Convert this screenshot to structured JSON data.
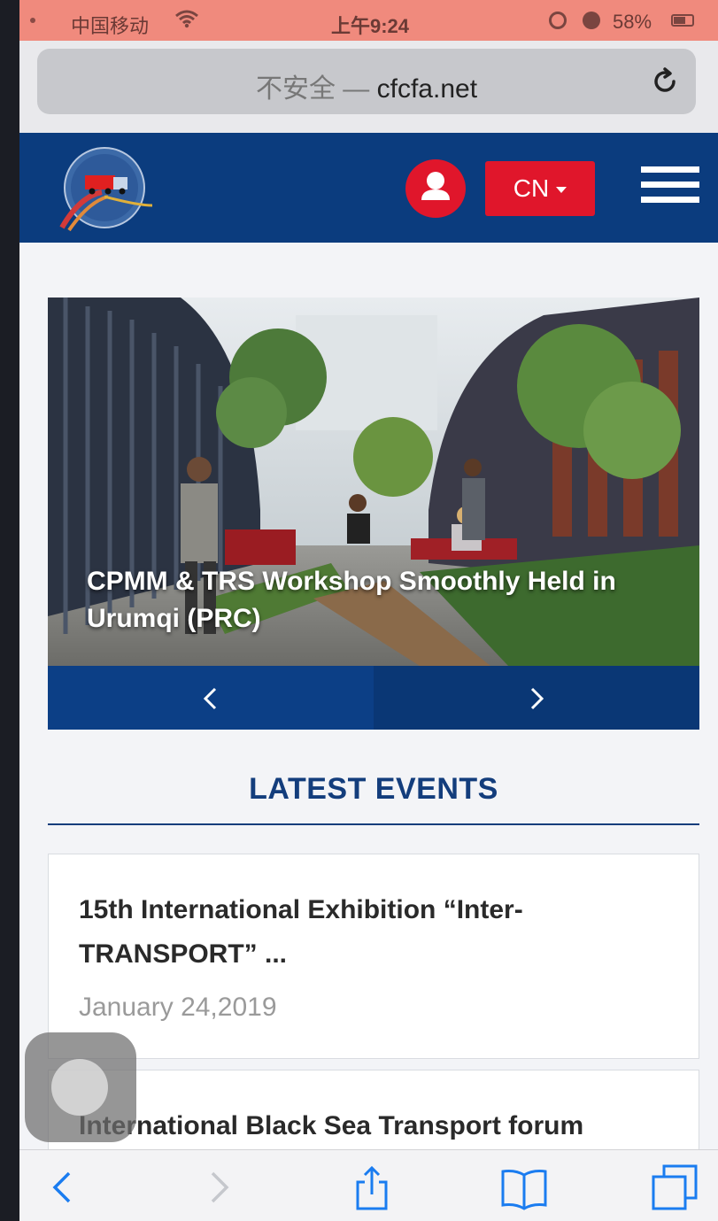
{
  "status_bar": {
    "carrier": "中国移动",
    "time": "上午9:24",
    "battery": "58%"
  },
  "browser": {
    "security_label": "不安全 —",
    "domain": "cfcfa.net"
  },
  "header": {
    "language": "CN",
    "brand_color": "#0b3c7e",
    "accent_color": "#e0162b"
  },
  "slider": {
    "caption": "CPMM & TRS Workshop Smoothly Held in Urumqi (PRC)"
  },
  "events": {
    "heading": "LATEST EVENTS",
    "items": [
      {
        "title": "15th International Exhibition “Inter-TRANSPORT” ...",
        "date": "January 24,2019"
      },
      {
        "title": "International Black Sea Transport forum"
      }
    ]
  },
  "icons": {
    "status": [
      "wifi-icon",
      "rotation-lock-icon",
      "alarm-icon",
      "battery-icon"
    ],
    "header": [
      "user-icon",
      "caret-down-icon",
      "hamburger-menu-icon"
    ],
    "toolbar": [
      "back-icon",
      "forward-icon",
      "share-icon",
      "bookmarks-icon",
      "tabs-icon"
    ]
  }
}
